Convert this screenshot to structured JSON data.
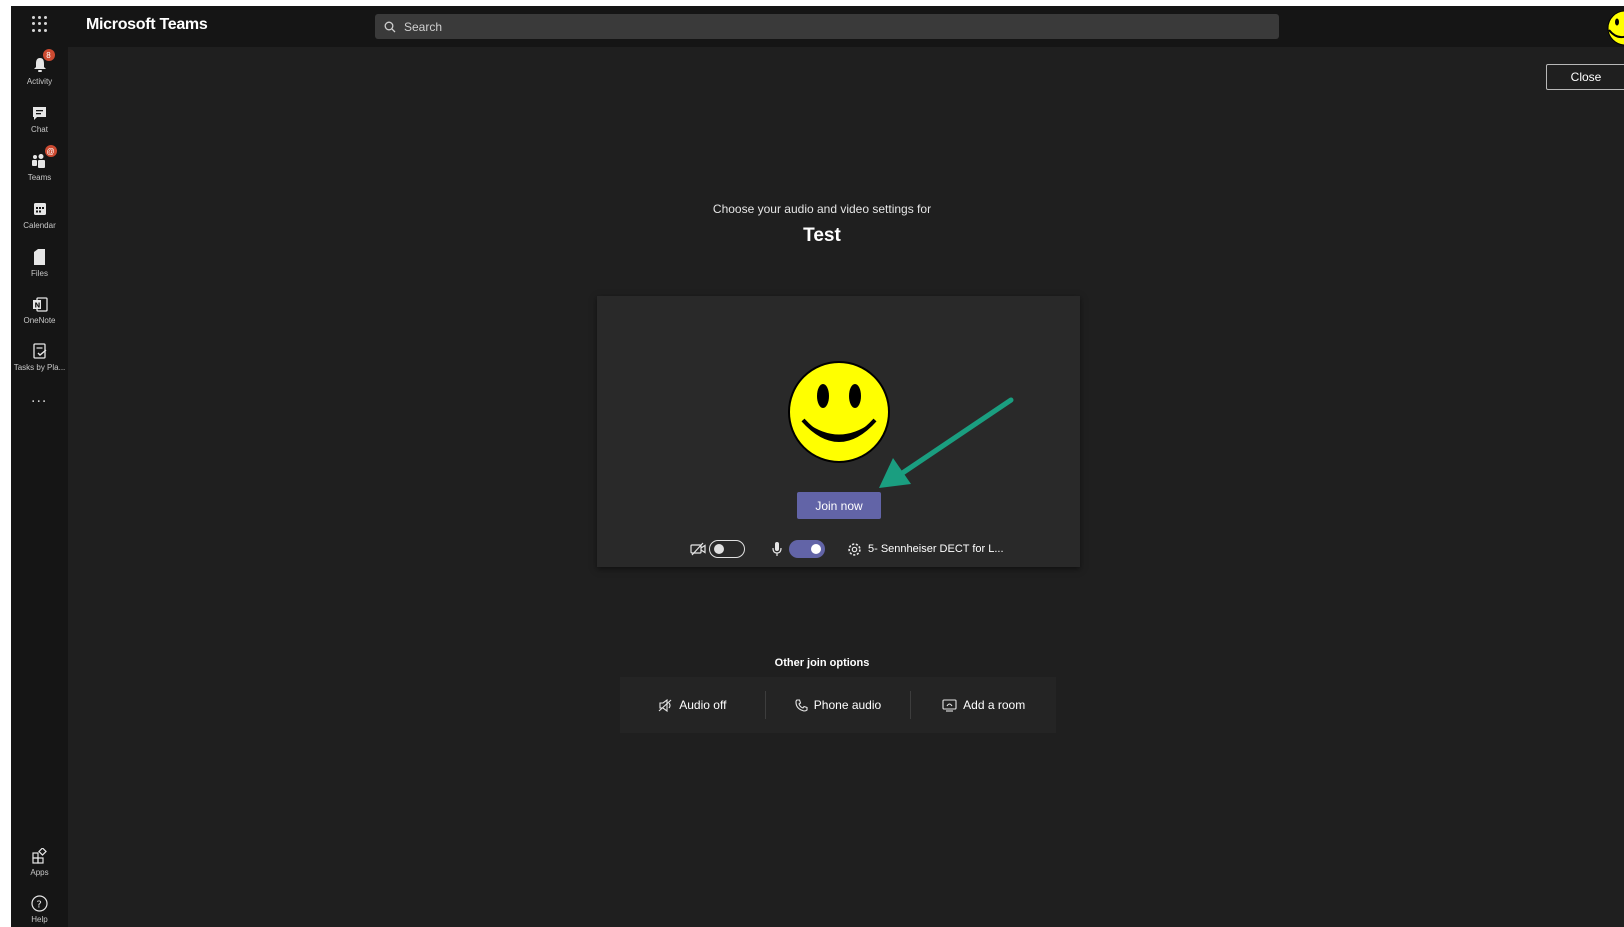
{
  "app": {
    "title": "Microsoft Teams"
  },
  "search": {
    "placeholder": "Search"
  },
  "rail": {
    "items": [
      {
        "label": "Activity",
        "icon": "bell-icon",
        "badge": "8"
      },
      {
        "label": "Chat",
        "icon": "chat-icon"
      },
      {
        "label": "Teams",
        "icon": "teams-icon",
        "badge": "@"
      },
      {
        "label": "Calendar",
        "icon": "calendar-icon"
      },
      {
        "label": "Files",
        "icon": "files-icon"
      },
      {
        "label": "OneNote",
        "icon": "onenote-icon"
      },
      {
        "label": "Tasks by Pla...",
        "icon": "tasks-icon"
      }
    ],
    "more": "...",
    "bottom": [
      {
        "label": "Apps",
        "icon": "apps-icon"
      },
      {
        "label": "Help",
        "icon": "help-icon"
      }
    ]
  },
  "header": {
    "close_label": "Close"
  },
  "prejoin": {
    "subtitle": "Choose your audio and video settings for",
    "meeting_title": "Test",
    "join_label": "Join now",
    "camera_on": false,
    "mic_on": true,
    "device_label": "5- Sennheiser DECT for L..."
  },
  "other_options": {
    "title": "Other join options",
    "options": [
      {
        "label": "Audio off",
        "icon": "speaker-off-icon"
      },
      {
        "label": "Phone audio",
        "icon": "phone-icon"
      },
      {
        "label": "Add a room",
        "icon": "room-icon"
      }
    ]
  },
  "colors": {
    "accent": "#6264a7",
    "background": "#1f1f1f",
    "rail": "#151515",
    "badge": "#cc4a31",
    "arrow": "#1a9e80"
  }
}
